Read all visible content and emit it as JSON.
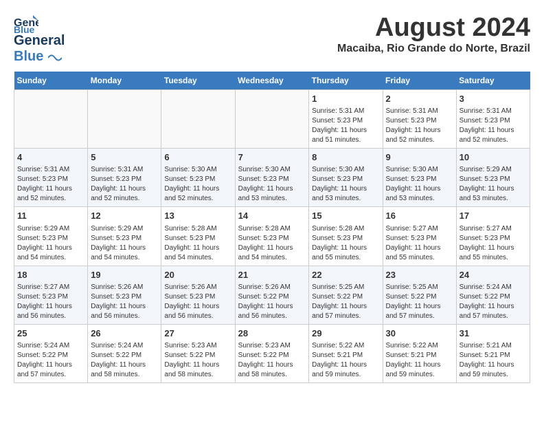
{
  "logo": {
    "line1": "General",
    "line2": "Blue"
  },
  "title": {
    "month_year": "August 2024",
    "location": "Macaiba, Rio Grande do Norte, Brazil"
  },
  "headers": [
    "Sunday",
    "Monday",
    "Tuesday",
    "Wednesday",
    "Thursday",
    "Friday",
    "Saturday"
  ],
  "weeks": [
    [
      {
        "day": "",
        "info": ""
      },
      {
        "day": "",
        "info": ""
      },
      {
        "day": "",
        "info": ""
      },
      {
        "day": "",
        "info": ""
      },
      {
        "day": "1",
        "info": "Sunrise: 5:31 AM\nSunset: 5:23 PM\nDaylight: 11 hours\nand 51 minutes."
      },
      {
        "day": "2",
        "info": "Sunrise: 5:31 AM\nSunset: 5:23 PM\nDaylight: 11 hours\nand 52 minutes."
      },
      {
        "day": "3",
        "info": "Sunrise: 5:31 AM\nSunset: 5:23 PM\nDaylight: 11 hours\nand 52 minutes."
      }
    ],
    [
      {
        "day": "4",
        "info": "Sunrise: 5:31 AM\nSunset: 5:23 PM\nDaylight: 11 hours\nand 52 minutes."
      },
      {
        "day": "5",
        "info": "Sunrise: 5:31 AM\nSunset: 5:23 PM\nDaylight: 11 hours\nand 52 minutes."
      },
      {
        "day": "6",
        "info": "Sunrise: 5:30 AM\nSunset: 5:23 PM\nDaylight: 11 hours\nand 52 minutes."
      },
      {
        "day": "7",
        "info": "Sunrise: 5:30 AM\nSunset: 5:23 PM\nDaylight: 11 hours\nand 53 minutes."
      },
      {
        "day": "8",
        "info": "Sunrise: 5:30 AM\nSunset: 5:23 PM\nDaylight: 11 hours\nand 53 minutes."
      },
      {
        "day": "9",
        "info": "Sunrise: 5:30 AM\nSunset: 5:23 PM\nDaylight: 11 hours\nand 53 minutes."
      },
      {
        "day": "10",
        "info": "Sunrise: 5:29 AM\nSunset: 5:23 PM\nDaylight: 11 hours\nand 53 minutes."
      }
    ],
    [
      {
        "day": "11",
        "info": "Sunrise: 5:29 AM\nSunset: 5:23 PM\nDaylight: 11 hours\nand 54 minutes."
      },
      {
        "day": "12",
        "info": "Sunrise: 5:29 AM\nSunset: 5:23 PM\nDaylight: 11 hours\nand 54 minutes."
      },
      {
        "day": "13",
        "info": "Sunrise: 5:28 AM\nSunset: 5:23 PM\nDaylight: 11 hours\nand 54 minutes."
      },
      {
        "day": "14",
        "info": "Sunrise: 5:28 AM\nSunset: 5:23 PM\nDaylight: 11 hours\nand 54 minutes."
      },
      {
        "day": "15",
        "info": "Sunrise: 5:28 AM\nSunset: 5:23 PM\nDaylight: 11 hours\nand 55 minutes."
      },
      {
        "day": "16",
        "info": "Sunrise: 5:27 AM\nSunset: 5:23 PM\nDaylight: 11 hours\nand 55 minutes."
      },
      {
        "day": "17",
        "info": "Sunrise: 5:27 AM\nSunset: 5:23 PM\nDaylight: 11 hours\nand 55 minutes."
      }
    ],
    [
      {
        "day": "18",
        "info": "Sunrise: 5:27 AM\nSunset: 5:23 PM\nDaylight: 11 hours\nand 56 minutes."
      },
      {
        "day": "19",
        "info": "Sunrise: 5:26 AM\nSunset: 5:23 PM\nDaylight: 11 hours\nand 56 minutes."
      },
      {
        "day": "20",
        "info": "Sunrise: 5:26 AM\nSunset: 5:23 PM\nDaylight: 11 hours\nand 56 minutes."
      },
      {
        "day": "21",
        "info": "Sunrise: 5:26 AM\nSunset: 5:22 PM\nDaylight: 11 hours\nand 56 minutes."
      },
      {
        "day": "22",
        "info": "Sunrise: 5:25 AM\nSunset: 5:22 PM\nDaylight: 11 hours\nand 57 minutes."
      },
      {
        "day": "23",
        "info": "Sunrise: 5:25 AM\nSunset: 5:22 PM\nDaylight: 11 hours\nand 57 minutes."
      },
      {
        "day": "24",
        "info": "Sunrise: 5:24 AM\nSunset: 5:22 PM\nDaylight: 11 hours\nand 57 minutes."
      }
    ],
    [
      {
        "day": "25",
        "info": "Sunrise: 5:24 AM\nSunset: 5:22 PM\nDaylight: 11 hours\nand 57 minutes."
      },
      {
        "day": "26",
        "info": "Sunrise: 5:24 AM\nSunset: 5:22 PM\nDaylight: 11 hours\nand 58 minutes."
      },
      {
        "day": "27",
        "info": "Sunrise: 5:23 AM\nSunset: 5:22 PM\nDaylight: 11 hours\nand 58 minutes."
      },
      {
        "day": "28",
        "info": "Sunrise: 5:23 AM\nSunset: 5:22 PM\nDaylight: 11 hours\nand 58 minutes."
      },
      {
        "day": "29",
        "info": "Sunrise: 5:22 AM\nSunset: 5:21 PM\nDaylight: 11 hours\nand 59 minutes."
      },
      {
        "day": "30",
        "info": "Sunrise: 5:22 AM\nSunset: 5:21 PM\nDaylight: 11 hours\nand 59 minutes."
      },
      {
        "day": "31",
        "info": "Sunrise: 5:21 AM\nSunset: 5:21 PM\nDaylight: 11 hours\nand 59 minutes."
      }
    ]
  ]
}
